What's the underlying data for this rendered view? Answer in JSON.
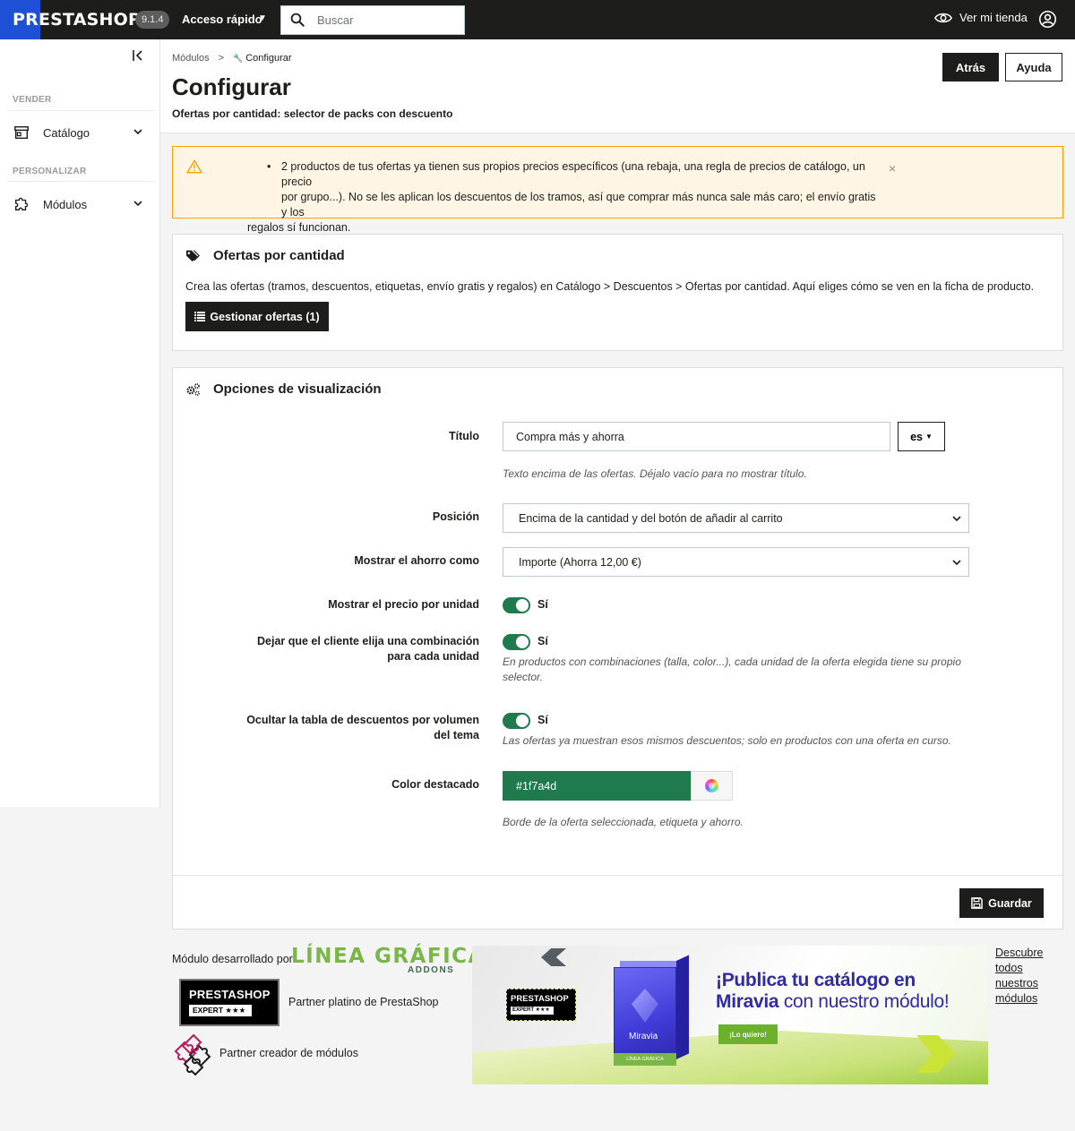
{
  "topbar": {
    "logo_text": "PRESTASHOP",
    "version": "9.1.4",
    "quick_access": "Acceso rápido",
    "search_placeholder": "Buscar",
    "view_store": "Ver mi tienda"
  },
  "sidebar": {
    "sections": [
      {
        "title": "VENDER",
        "items": [
          {
            "label": "Catálogo",
            "icon": "storefront-icon"
          }
        ]
      },
      {
        "title": "PERSONALIZAR",
        "items": [
          {
            "label": "Módulos",
            "icon": "puzzle-icon"
          }
        ]
      }
    ]
  },
  "header": {
    "breadcrumb": [
      "Módulos",
      ">",
      "Configurar"
    ],
    "title": "Configurar",
    "subtitle": "Ofertas por cantidad: selector de packs con descuento",
    "back_label": "Atrás",
    "help_label": "Ayuda"
  },
  "alert": {
    "bullet": "•",
    "line1": "2 productos de tus ofertas ya tienen sus propios precios específicos (una rebaja, una regla de precios de catálogo, un precio",
    "line2": "por grupo...). No se les aplican los descuentos de los tramos, así que comprar más nunca sale más caro; el envío gratis y los",
    "line3": "regalos sí funcionan.",
    "close": "×"
  },
  "offers_panel": {
    "title": "Ofertas por cantidad",
    "text": "Crea las ofertas (tramos, descuentos, etiquetas, envío gratis y regalos) en Catálogo > Descuentos > Ofertas por cantidad. Aquí eliges cómo se ven en la ficha de producto.",
    "button": "Gestionar ofertas (1)"
  },
  "display_panel": {
    "title": "Opciones de visualización",
    "title_field": {
      "label": "Título",
      "value": "Compra más y ahorra",
      "lang": "es",
      "help": "Texto encima de las ofertas. Déjalo vacío para no mostrar título."
    },
    "position": {
      "label": "Posición",
      "value": "Encima de la cantidad y del botón de añadir al carrito"
    },
    "savings": {
      "label": "Mostrar el ahorro como",
      "value": "Importe (Ahorra 12,00 €)"
    },
    "unit_price": {
      "label": "Mostrar el precio por unidad",
      "state": "Sí"
    },
    "combination": {
      "label_line1": "Dejar que el cliente elija una combinación",
      "label_line2": "para cada unidad",
      "state": "Sí",
      "help_line1": "En productos con combinaciones (talla, color...), cada unidad de la oferta elegida tiene su propio",
      "help_line2": "selector."
    },
    "hide_table": {
      "label_line1": "Ocultar la tabla de descuentos por volumen",
      "label_line2": "del tema",
      "state": "Sí",
      "help": "Las ofertas ya muestran esos mismos descuentos; solo en productos con una oferta en curso."
    },
    "color": {
      "label": "Color destacado",
      "value": "#1f7a4d",
      "help": "Borde de la oferta seleccionada, etiqueta y ahorro."
    },
    "save_label": "Guardar"
  },
  "footer": {
    "developed_by": "Módulo desarrollado por",
    "lg_logo": "LÍNEA GRÁFICA",
    "lg_addons": "ADDONS",
    "ps_badge_title": "PRESTASHOP",
    "ps_badge_sub": "EXPERT ★★★",
    "partner_platinum": "Partner platino de PrestaShop",
    "partner_creator": "Partner creador de módulos",
    "banner": {
      "headline_bold": "¡Publica tu catálogo en",
      "headline_brand": "Miravia",
      "headline_rest": " con nuestro módulo!",
      "cta": "¡Lo quiero!",
      "box_name": "Miravia",
      "box_foot": "LÍNEA GRÁFICA",
      "badge_title": "PRESTASHOP",
      "badge_sub": "EXPERT ★★★"
    },
    "discover": "Descubre todos nuestros módulos"
  },
  "colors": {
    "accent": "#1f7a4d",
    "topbar": "#1d1d1b",
    "logo_bg": "#1e50d6",
    "alert_bg": "#fff5e5",
    "alert_border": "#ffa000"
  }
}
